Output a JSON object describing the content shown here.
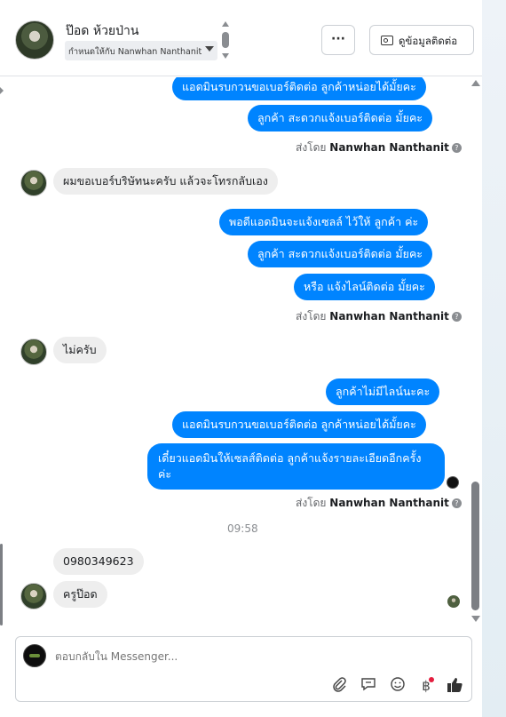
{
  "header": {
    "contact_name": "ป๊อด ห้วยป่าน",
    "assigned_to": "กำหนดให้กับ Nanwhan Nanthanit",
    "more_label": "···",
    "contact_info_label": "ดูข้อมูลติดต่อ"
  },
  "messages": [
    {
      "dir": "out",
      "text": "แอดมินรบกวนขอเบอร์ติดต่อ ลูกค้าหน่อยได้มั้ยคะ"
    },
    {
      "dir": "out",
      "text": "ลูกค้า สะดวกแจ้งเบอร์ติดต่อ มั้ยคะ"
    },
    {
      "dir": "in",
      "text": "ผมขอเบอร์บริษัทนะครับ แล้วจะโทรกลับเอง"
    },
    {
      "dir": "out",
      "text": "พอดีแอดมินจะแจ้งเซลล์ ไว้ให้ ลูกค้า ค่ะ"
    },
    {
      "dir": "out",
      "text": "ลูกค้า สะดวกแจ้งเบอร์ติดต่อ มั้ยคะ"
    },
    {
      "dir": "out",
      "text": "หรือ แจ้งไลน์ติดต่อ มั้ยคะ"
    },
    {
      "dir": "in",
      "text": "ไม่ครับ"
    },
    {
      "dir": "out",
      "text": "ลูกค้าไม่มีไลน์นะคะ"
    },
    {
      "dir": "out",
      "text": "แอดมินรบกวนขอเบอร์ติดต่อ ลูกค้าหน่อยได้มั้ยคะ"
    },
    {
      "dir": "out",
      "text": "เดี๋ยวแอดมินให้เซลส์ติดต่อ ลูกค้าแจ้งรายละเอียดอีกครั้ง ค่ะ"
    },
    {
      "dir": "in",
      "text": "0980349623"
    },
    {
      "dir": "in",
      "text": "ครูป๊อด"
    }
  ],
  "sent_by": {
    "prefix": "ส่งโดย",
    "name": "Nanwhan Nanthanit",
    "help_icon": "?"
  },
  "time_separator": "09:58",
  "composer": {
    "placeholder": "ตอบกลับใน Messenger...",
    "icons": [
      "paperclip-icon",
      "saved-reply-icon",
      "emoji-icon",
      "baht-payment-icon",
      "thumbs-up-icon"
    ]
  },
  "colors": {
    "outgoing_bubble": "#0084ff",
    "incoming_bubble": "#eeeeee",
    "notification_dot": "#e41e3f"
  }
}
